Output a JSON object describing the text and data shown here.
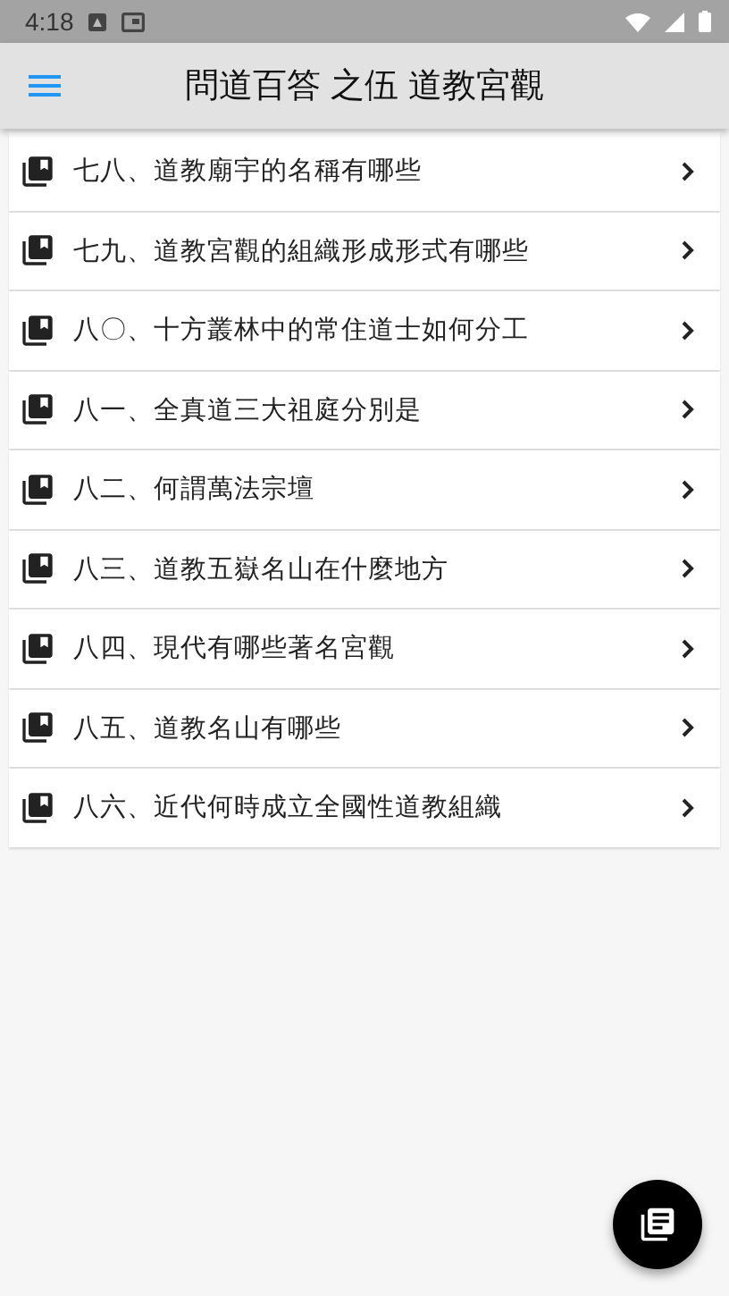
{
  "status_bar": {
    "time": "4:18"
  },
  "app_bar": {
    "title": "問道百答 之伍 道教宮觀"
  },
  "items": [
    {
      "label": "七八、道教廟宇的名稱有哪些"
    },
    {
      "label": "七九、道教宮觀的組織形成形式有哪些"
    },
    {
      "label": "八〇、十方叢林中的常住道士如何分工"
    },
    {
      "label": "八一、全真道三大祖庭分別是"
    },
    {
      "label": "八二、何謂萬法宗壇"
    },
    {
      "label": "八三、道教五嶽名山在什麼地方"
    },
    {
      "label": "八四、現代有哪些著名宮觀"
    },
    {
      "label": "八五、道教名山有哪些"
    },
    {
      "label": "八六、近代何時成立全國性道教組織"
    }
  ]
}
